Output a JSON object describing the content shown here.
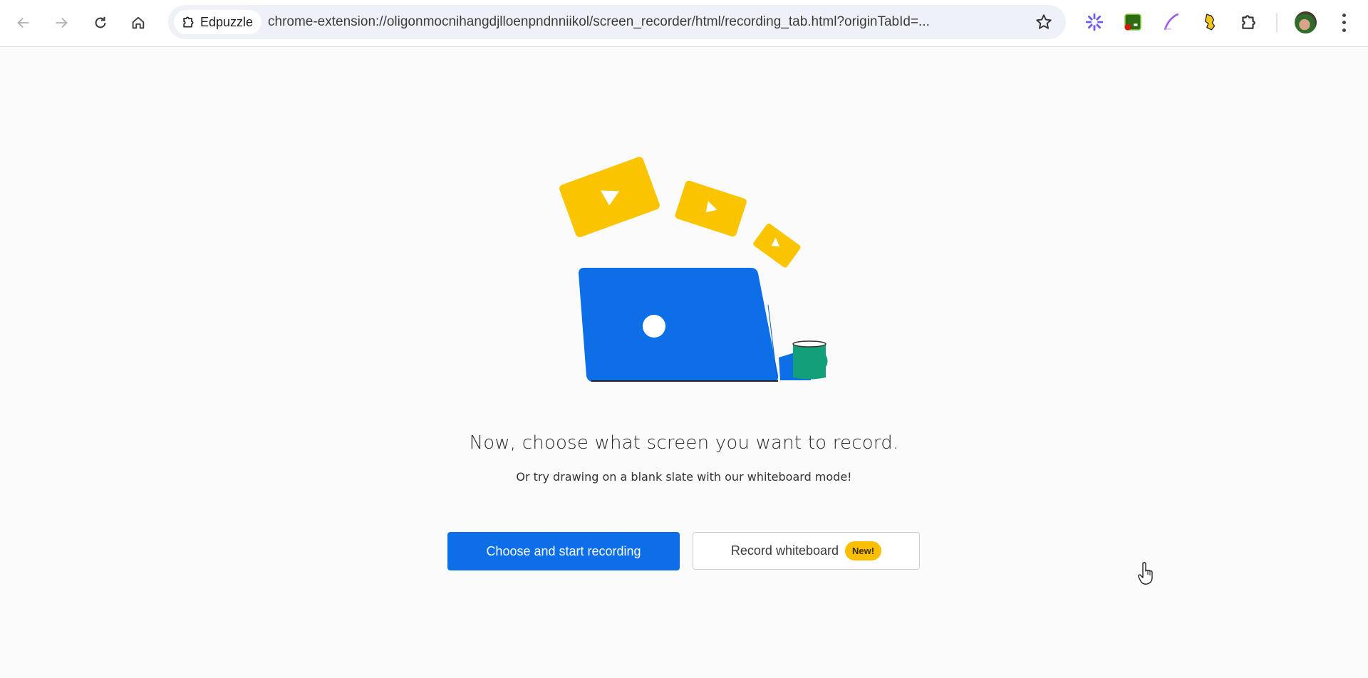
{
  "browser": {
    "nav": {
      "back_icon": "arrow-left-icon",
      "forward_icon": "arrow-right-icon",
      "reload_icon": "reload-icon",
      "home_icon": "home-icon"
    },
    "omnibox": {
      "site_chip_label": "Edpuzzle",
      "site_chip_icon": "extension-puzzle-icon",
      "url": "chrome-extension://oligonmocnihangdjlloenpndnniikol/screen_recorder/html/recording_tab.html?originTabId=...",
      "bookmark_icon": "star-icon"
    },
    "extensions": [
      {
        "name": "asterisk-extension",
        "color": "#6a5cf0"
      },
      {
        "name": "screen-recorder-extension",
        "color": "#3a7a17"
      },
      {
        "name": "quill-extension",
        "color": "#9b5de5"
      },
      {
        "name": "honey-extension",
        "color": "#f5c518"
      },
      {
        "name": "extensions-menu",
        "color": "#333333"
      }
    ],
    "profile_avatar": "avatar",
    "menu_icon": "more-vert-icon"
  },
  "main": {
    "heading": "Now, choose what screen you want to record.",
    "subtext": "Or try drawing on a blank slate with our whiteboard mode!",
    "primary_button": "Choose and start recording",
    "secondary_button": "Record whiteboard",
    "badge": "New!"
  },
  "colors": {
    "accent_blue": "#0d6fe8",
    "video_yellow": "#fbc400",
    "mug_green": "#12a07a",
    "badge_yellow": "#fbbf00"
  }
}
